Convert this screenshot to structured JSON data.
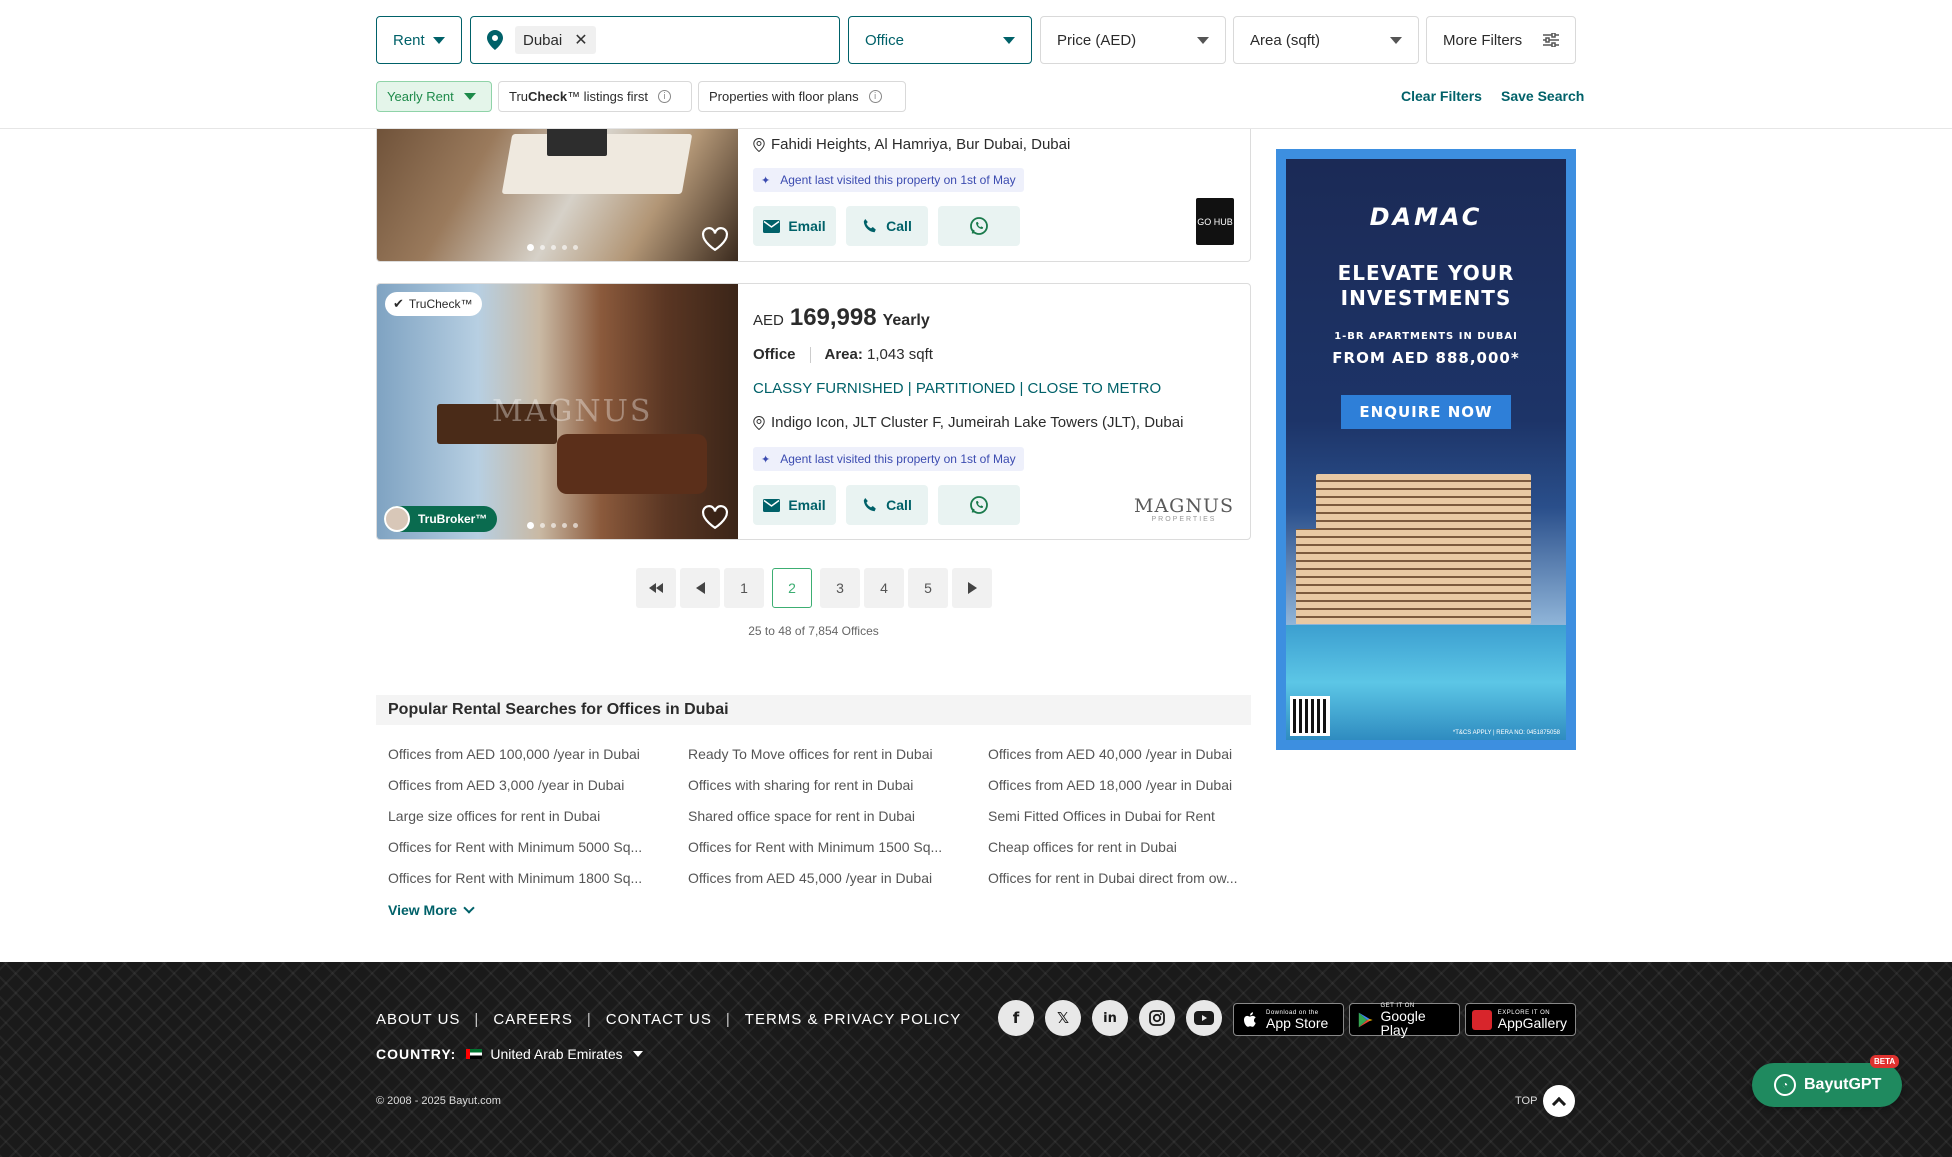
{
  "filters": {
    "purpose": "Rent",
    "location_chip": "Dubai",
    "category": "Office",
    "price": "Price (AED)",
    "area": "Area (sqft)",
    "more_filters": "More Filters",
    "chips": {
      "rent_frequency": "Yearly Rent",
      "trucheck_prefix": "Tru",
      "trucheck_bold": "Check",
      "trucheck_suffix": "™ listings first",
      "floor_plans": "Properties with floor plans"
    },
    "clear_filters": "Clear Filters",
    "save_search": "Save Search"
  },
  "listings": [
    {
      "address": "Fahidi Heights, Al Hamriya, Bur Dubai, Dubai",
      "visited": "Agent last visited this property on 1st of May",
      "email": "Email",
      "call": "Call",
      "agency_logo_text": "GO HUB"
    },
    {
      "badge": "TruCheck™",
      "currency": "AED",
      "price": "169,998",
      "period": "Yearly",
      "type": "Office",
      "area_label": "Area:",
      "area_value": "1,043 sqft",
      "title": "CLASSY FURNISHED | PARTITIONED | CLOSE TO METRO",
      "address": "Indigo Icon, JLT Cluster F, Jumeirah Lake Towers (JLT), Dubai",
      "visited": "Agent last visited this property on 1st of May",
      "email": "Email",
      "call": "Call",
      "broker_badge": "TruBroker™",
      "photo_watermark": "MAGNUS",
      "agency_logo_text": "MAGNUS",
      "agency_logo_sub": "PROPERTIES"
    }
  ],
  "pagination": {
    "pages": [
      "1",
      "2",
      "3",
      "4",
      "5"
    ],
    "current": "2",
    "info": "25 to 48 of 7,854 Offices"
  },
  "popular": {
    "title": "Popular Rental Searches for Offices in Dubai",
    "links": [
      "Offices from AED 100,000 /year in Dubai",
      "Ready To Move offices for rent in Dubai",
      "Offices from AED 40,000 /year in Dubai",
      "Offices from AED 3,000 /year in Dubai",
      "Offices with sharing for rent in Dubai",
      "Offices from AED 18,000 /year in Dubai",
      "Large size offices for rent in Dubai",
      "Shared office space for rent in Dubai",
      "Semi Fitted Offices in Dubai for Rent",
      "Offices for Rent with Minimum 5000 Sq...",
      "Offices for Rent with Minimum 1500 Sq...",
      "Cheap offices for rent in Dubai",
      "Offices for Rent with Minimum 1800 Sq...",
      "Offices from AED 45,000 /year in Dubai",
      "Offices for rent in Dubai direct from ow..."
    ],
    "view_more": "View More"
  },
  "ad": {
    "brand": "DAMAC",
    "headline_1": "ELEVATE YOUR",
    "headline_2": "INVESTMENTS",
    "sub": "1-BR APARTMENTS IN DUBAI",
    "from": "FROM AED 888,000*",
    "cta": "ENQUIRE NOW",
    "fine_print": "*T&CS APPLY | RERA NO: 0451875058"
  },
  "footer": {
    "links": [
      "ABOUT US",
      "CAREERS",
      "CONTACT US",
      "TERMS & PRIVACY POLICY"
    ],
    "country_label": "COUNTRY:",
    "country": "United Arab Emirates",
    "copyright": "© 2008 - 2025 Bayut.com",
    "top": "TOP",
    "stores": [
      {
        "small": "Download on the",
        "big": "App Store"
      },
      {
        "small": "GET IT ON",
        "big": "Google Play"
      },
      {
        "small": "EXPLORE IT ON",
        "big": "AppGallery"
      }
    ],
    "socials": [
      "facebook-icon",
      "x-icon",
      "linkedin-icon",
      "instagram-icon",
      "youtube-icon"
    ]
  },
  "assistant": {
    "label": "BayutGPT",
    "beta": "BETA"
  },
  "colors": {
    "brand_teal": "#006169",
    "active_green": "#3cae72",
    "footer_bg": "#1a1a1a",
    "gpt_green": "#1f8a5f"
  }
}
